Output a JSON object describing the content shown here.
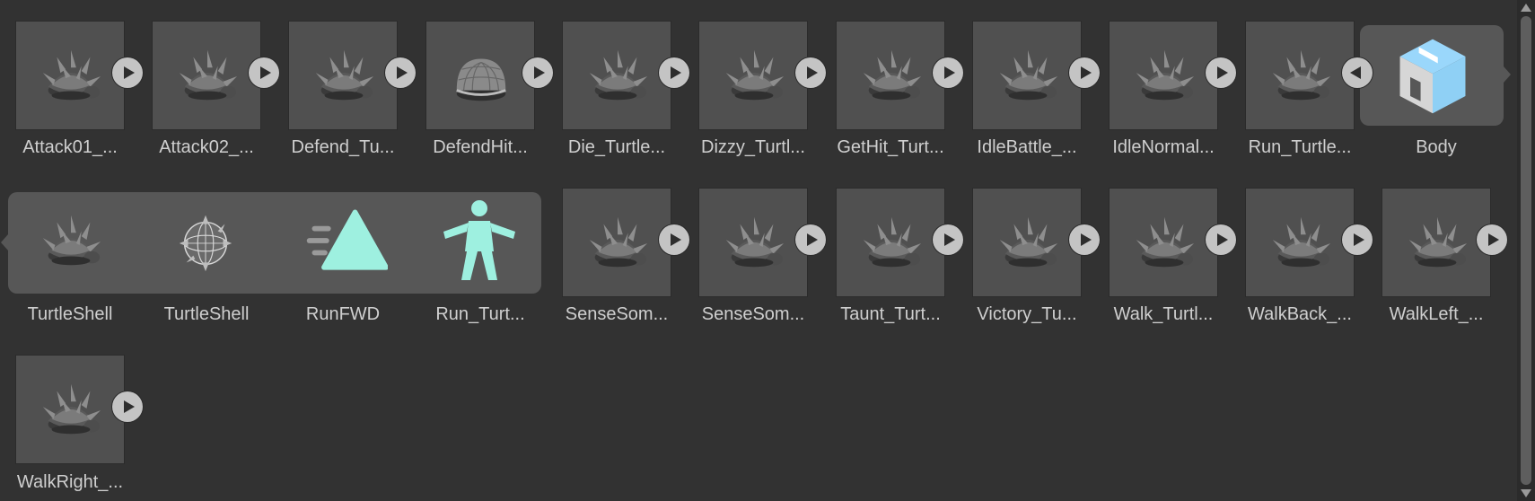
{
  "assets": [
    {
      "label": "Attack01_...",
      "icon": "turtle-shell-mesh-icon",
      "button": "play"
    },
    {
      "label": "Attack02_...",
      "icon": "turtle-shell-mesh-icon",
      "button": "play"
    },
    {
      "label": "Defend_Tu...",
      "icon": "turtle-shell-mesh-icon",
      "button": "play"
    },
    {
      "label": "DefendHit...",
      "icon": "turtle-shell-dome-icon",
      "button": "play"
    },
    {
      "label": "Die_Turtle...",
      "icon": "turtle-shell-mesh-icon",
      "button": "play"
    },
    {
      "label": "Dizzy_Turtl...",
      "icon": "turtle-shell-mesh-icon",
      "button": "play"
    },
    {
      "label": "GetHit_Turt...",
      "icon": "turtle-shell-mesh-icon",
      "button": "play"
    },
    {
      "label": "IdleBattle_...",
      "icon": "turtle-shell-mesh-icon",
      "button": "play"
    },
    {
      "label": "IdleNormal...",
      "icon": "turtle-shell-mesh-icon",
      "button": "play"
    },
    {
      "label": "Run_Turtle...",
      "icon": "turtle-shell-mesh-icon",
      "button": "collapse"
    },
    {
      "label": "Body",
      "icon": "prefab-cube-icon",
      "button": "none"
    },
    {
      "label": "SenseSom...",
      "icon": "turtle-shell-mesh-icon",
      "button": "play"
    },
    {
      "label": "SenseSom...",
      "icon": "turtle-shell-mesh-icon",
      "button": "play"
    },
    {
      "label": "Taunt_Turt...",
      "icon": "turtle-shell-mesh-icon",
      "button": "play"
    },
    {
      "label": "Victory_Tu...",
      "icon": "turtle-shell-mesh-icon",
      "button": "play"
    },
    {
      "label": "Walk_Turtl...",
      "icon": "turtle-shell-mesh-icon",
      "button": "play"
    },
    {
      "label": "WalkBack_...",
      "icon": "turtle-shell-mesh-icon",
      "button": "play"
    },
    {
      "label": "WalkLeft_...",
      "icon": "turtle-shell-mesh-icon",
      "button": "play"
    },
    {
      "label": "WalkRight_...",
      "icon": "turtle-shell-mesh-icon",
      "button": "play"
    }
  ],
  "expanded_subassets": [
    {
      "label": "TurtleShell",
      "icon": "turtle-shell-mesh-icon"
    },
    {
      "label": "TurtleShell",
      "icon": "wireframe-mesh-icon"
    },
    {
      "label": "RunFWD",
      "icon": "animation-clip-icon"
    },
    {
      "label": "Run_Turt...",
      "icon": "avatar-humanoid-icon"
    }
  ],
  "colors": {
    "background": "#323232",
    "tile": "#505050",
    "expanded_panel": "#575757",
    "accent_teal": "#9ef0e0",
    "prefab_blue": "#8fd0f5"
  }
}
